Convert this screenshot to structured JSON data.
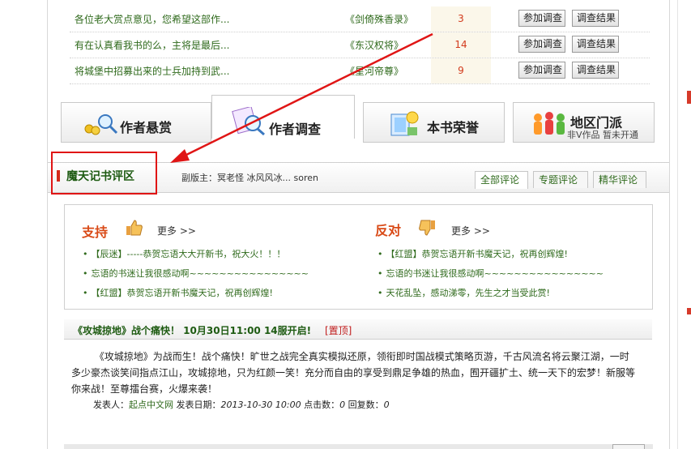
{
  "survey": [
    {
      "title": "各位老大赏点意见，您希望这部作...",
      "book": "《剑倚殊香录》",
      "count": "3",
      "join": "参加调查",
      "result": "调查结果"
    },
    {
      "title": "有在认真看我书的么，主将是最后...",
      "book": "《东汉权将》",
      "count": "14",
      "join": "参加调查",
      "result": "调查结果"
    },
    {
      "title": "将城堡中招募出来的士兵加持到武...",
      "book": "《星河帝尊》",
      "count": "9",
      "join": "参加调查",
      "result": "调查结果"
    }
  ],
  "tabs": {
    "reward": "作者悬赏",
    "survey": "作者调查",
    "honor": "本书荣誉",
    "region": "地区门派",
    "region_sub": "非V作品 暂未开通"
  },
  "comments": {
    "title": "魔天记书评区",
    "mods": "副版主：冥老怪 冰风风冰... soren",
    "tabs": [
      "全部评论",
      "专题评论",
      "精华评论"
    ]
  },
  "support": {
    "label": "支持",
    "more": "更多 >>",
    "items": [
      "【辰迷】-----恭贺忘语大大开新书，祝大火！！！",
      "忘语的书迷让我很感动啊~~~~~~~~~~~~~~~~",
      "【红盟】恭贺忘语开新书魔天记，祝再创辉煌!"
    ]
  },
  "oppose": {
    "label": "反对",
    "more": "更多 >>",
    "items": [
      "【红盟】恭贺忘语开新书魔天记，祝再创辉煌!",
      "忘语的书迷让我很感动啊~~~~~~~~~~~~~~~~",
      "天花乱坠，感动涕零，先生之才当受此赏!"
    ]
  },
  "announcement": {
    "title": "《攻城掠地》战个痛快！ 10月30日11:00 14服开启!",
    "pinned": "[置顶]",
    "body": "《攻城掠地》为战而生！战个痛快！旷世之战完全真实模拟还原，领衔即时国战模式策略页游，千古风流名将云聚江湖，一时多少豪杰谈笑间指点江山，攻城掠地，只为红颜一笑！充分而自由的享受到鼎足争雄的热血，囿开疆扩土、统一天下的宏梦！新服等你来战！至尊擂台赛，火爆来袭！",
    "publisher_label": "发表人：",
    "publisher": "起点中文网",
    "date_label": "发表日期：",
    "date": "2013-10-30 10:00",
    "clicks_label": "点击数：",
    "clicks": "0",
    "replies_label": "回复数：",
    "replies": "0"
  },
  "colors": {
    "annotation": "#e01515",
    "link_green": "#2f6a1c",
    "accent_red": "#d23a1c"
  }
}
